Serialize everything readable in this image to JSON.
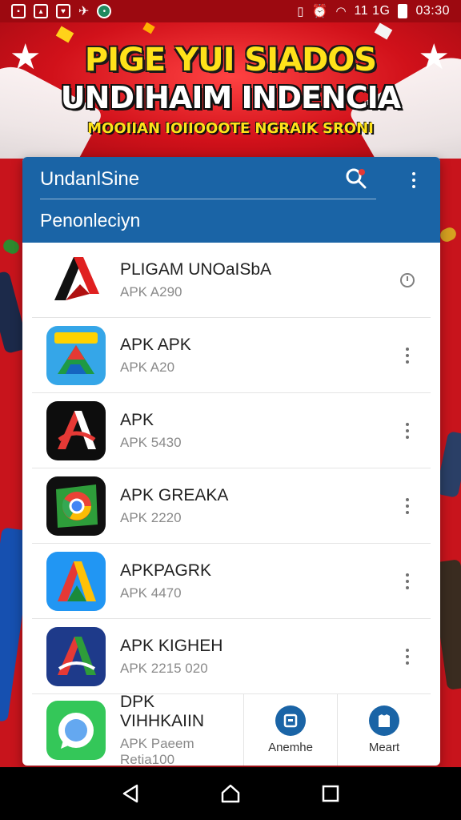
{
  "status_bar": {
    "signal_text": "11 1G",
    "time": "03:30",
    "icons": [
      "screenshot-icon",
      "image-icon",
      "shield-icon",
      "wifi-icon",
      "app-icon",
      "vibrate-icon",
      "alarm-icon",
      "wifi-icon",
      "battery-icon"
    ]
  },
  "banner": {
    "line1": "PIGE YUI SIADOS",
    "line2": "UNDIHAIM INDENCIA",
    "line3": "MOOIIAN IOIIOOOTE NGRAIK SRONI"
  },
  "card": {
    "title": "UndanlSine",
    "subtitle": "Penonleciyn",
    "accent": "#1a64a6"
  },
  "apps": [
    {
      "name": "PLIGAM UNOaISbA",
      "meta": "APK A290",
      "icon": "red-black-a-logo",
      "action": "timer-icon"
    },
    {
      "name": "APK APK",
      "meta": "APK A20",
      "icon": "drive-triangle-logo",
      "action": "more-icon"
    },
    {
      "name": "APK",
      "meta": "APK 5430",
      "icon": "black-red-a-logo",
      "action": "more-icon"
    },
    {
      "name": "APK GREAKA",
      "meta": "APK 2220",
      "icon": "chrome-green-logo",
      "action": "more-icon"
    },
    {
      "name": "APKPAGRK",
      "meta": "APK 4470",
      "icon": "blue-a-logo",
      "action": "more-icon"
    },
    {
      "name": "APK KIGHEH",
      "meta": "APK 2215 020",
      "icon": "navy-a-logo",
      "action": "more-icon"
    }
  ],
  "bottom": {
    "app_name": "DPK VIHHKAIIN",
    "app_meta": "APK Paeem Retia100",
    "btn1_label": "Anemhe",
    "btn2_label": "Meart"
  }
}
